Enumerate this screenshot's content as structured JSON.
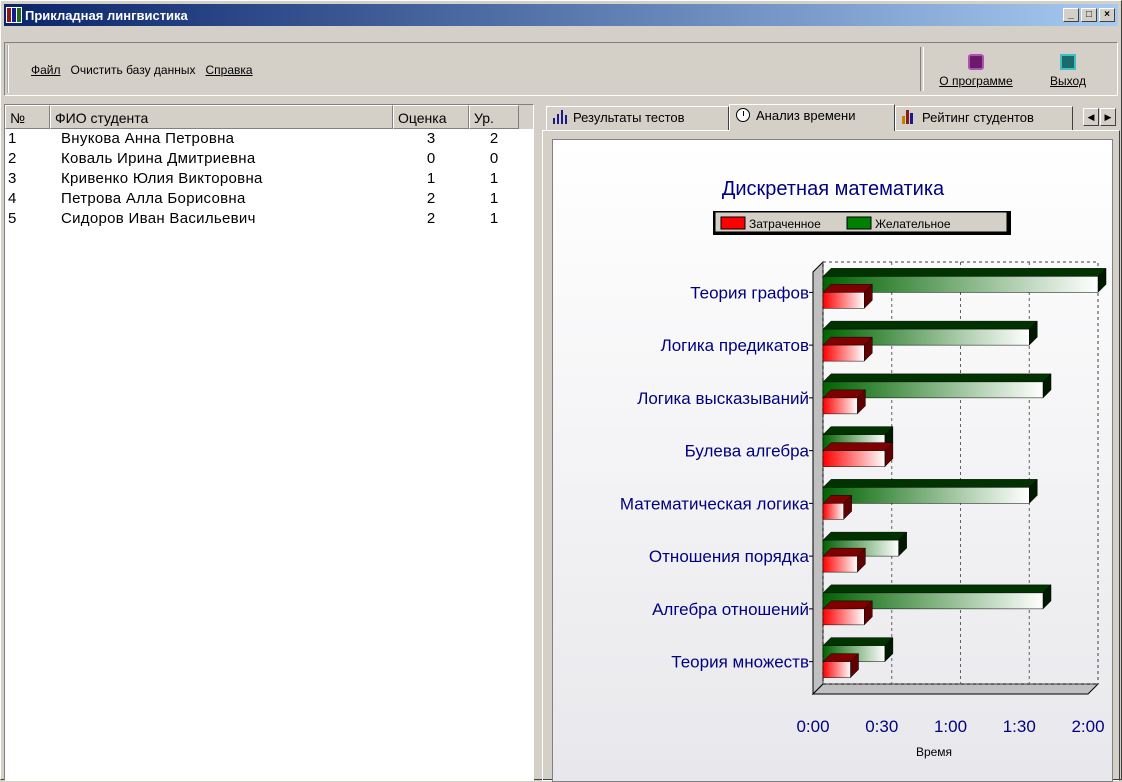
{
  "window": {
    "title": "Прикладная лингвистика",
    "minimize": "_",
    "maximize": "□",
    "close": "×"
  },
  "menu": [
    {
      "label": "Файл"
    },
    {
      "label": "Очистить базу данных"
    },
    {
      "label": "Справка"
    }
  ],
  "toolbar": {
    "about_label": "О программе",
    "exit_label": "Выход"
  },
  "grid": {
    "headers": {
      "num": "№",
      "fio": "ФИО студента",
      "grade": "Оценка",
      "level": "Ур."
    },
    "rows": [
      {
        "num": "1",
        "fio": "Внукова Анна Петровна",
        "grade": "3",
        "level": "2"
      },
      {
        "num": "2",
        "fio": "Коваль Ирина Дмитриевна",
        "grade": "0",
        "level": "0"
      },
      {
        "num": "3",
        "fio": "Кривенко Юлия Викторовна",
        "grade": "1",
        "level": "1"
      },
      {
        "num": "4",
        "fio": "Петрова Алла Борисовна",
        "grade": "2",
        "level": "1"
      },
      {
        "num": "5",
        "fio": "Сидоров Иван Васильевич",
        "grade": "2",
        "level": "1"
      }
    ]
  },
  "tabs": [
    {
      "label": "Результаты тестов"
    },
    {
      "label": "Анализ времени"
    },
    {
      "label": "Рейтинг студентов"
    }
  ],
  "chart_data": {
    "type": "bar",
    "orientation": "horizontal",
    "title": "Дискретная математика",
    "xlabel": "Время",
    "ylabel": "",
    "categories": [
      "Теория графов",
      "Логика предикатов",
      "Логика высказываний",
      "Булева алгебра",
      "Математическая логика",
      "Отношения порядка",
      "Алгебра отношений",
      "Теория множеств"
    ],
    "series": [
      {
        "name": "Затраченное",
        "color": "#ff0000",
        "values_seconds": [
          18,
          18,
          15,
          27,
          9,
          15,
          18,
          12
        ]
      },
      {
        "name": "Желательное",
        "color": "#008000",
        "values_seconds": [
          120,
          90,
          96,
          27,
          90,
          33,
          96,
          27
        ]
      }
    ],
    "xlim_seconds": [
      0,
      120
    ],
    "xticks": [
      "0:00",
      "0:30",
      "1:00",
      "1:30",
      "2:00"
    ],
    "legend_position": "top",
    "grid": true
  }
}
